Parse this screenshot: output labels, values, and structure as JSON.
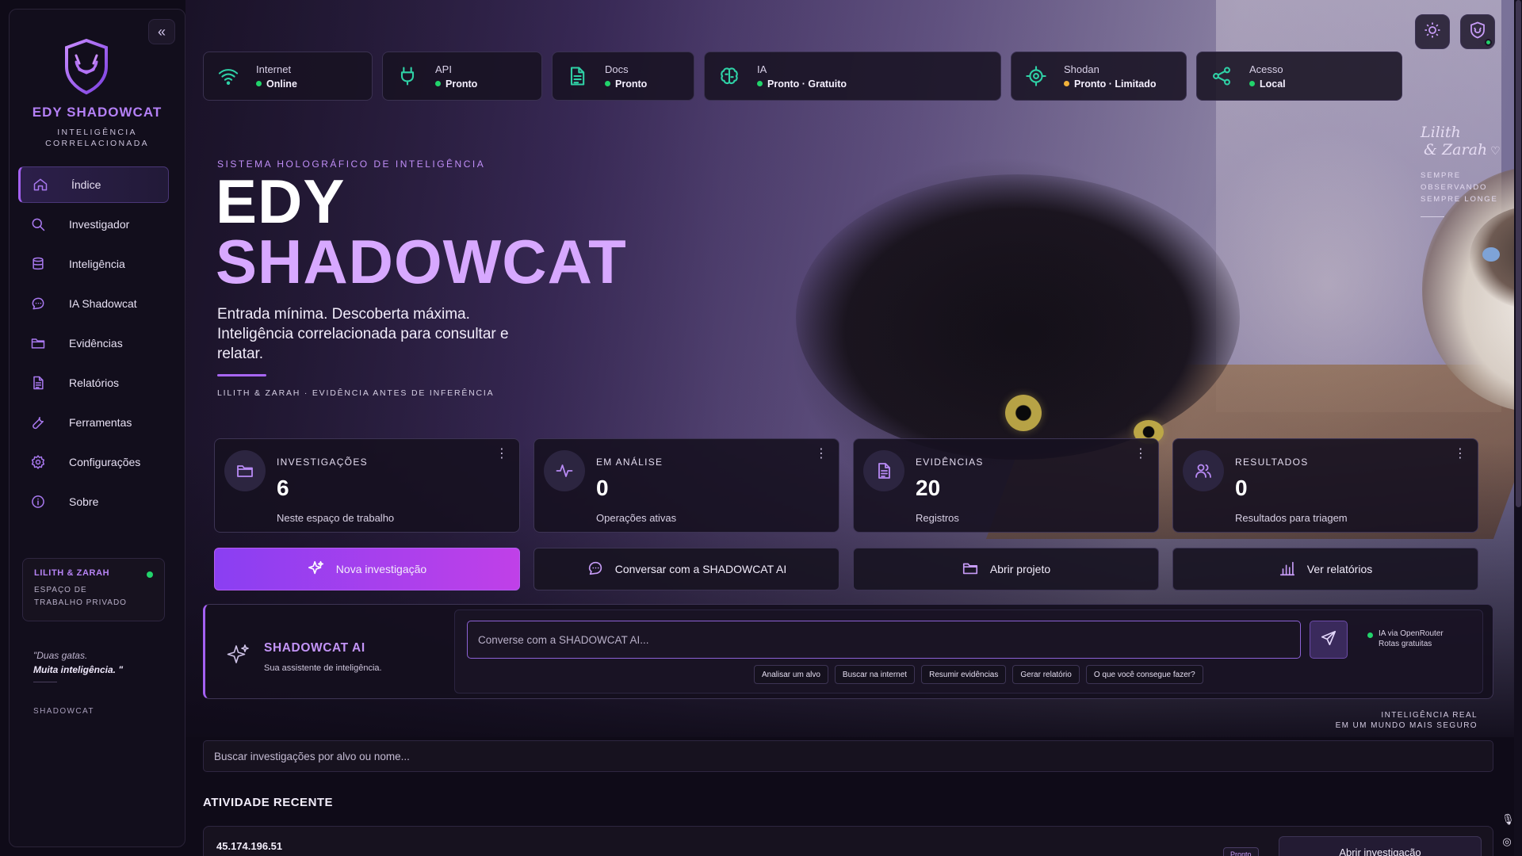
{
  "sidebar": {
    "brand_name": "EDY SHADOWCAT",
    "brand_sub": "INTELIGÊNCIA CORRELACIONADA",
    "collapse_glyph": "«",
    "items": [
      {
        "label": "Índice",
        "icon": "home-icon",
        "active": true
      },
      {
        "label": "Investigador",
        "icon": "search-icon"
      },
      {
        "label": "Inteligência",
        "icon": "database-icon"
      },
      {
        "label": "IA Shadowcat",
        "icon": "chat-icon"
      },
      {
        "label": "Evidências",
        "icon": "folder-icon"
      },
      {
        "label": "Relatórios",
        "icon": "document-icon"
      },
      {
        "label": "Ferramentas",
        "icon": "wrench-icon"
      },
      {
        "label": "Configurações",
        "icon": "gear-icon"
      },
      {
        "label": "Sobre",
        "icon": "info-icon"
      }
    ],
    "workspace": {
      "title": "LILITH & ZARAH",
      "subtitle": "ESPAÇO DE TRABALHO PRIVADO"
    },
    "quote_line1": "\"Duas gatas.",
    "quote_line2": "Muita inteligência. \"",
    "signature": "SHADOWCAT"
  },
  "status": [
    {
      "label": "Internet",
      "value": "Online",
      "icon": "wifi-icon",
      "dot_color": "#22d36b"
    },
    {
      "label": "API",
      "value": "Pronto",
      "icon": "plug-icon",
      "dot_color": "#22d36b"
    },
    {
      "label": "Docs",
      "value": "Pronto",
      "icon": "document-icon",
      "dot_color": "#22d36b"
    },
    {
      "label": "IA",
      "value": "Pronto · Gratuito",
      "icon": "brain-icon",
      "dot_color": "#22d36b"
    },
    {
      "label": "Shodan",
      "value": "Pronto · Limitado",
      "icon": "target-icon",
      "dot_color": "#f2b23a"
    },
    {
      "label": "Acesso",
      "value": "Local",
      "icon": "share-icon",
      "dot_color": "#22d36b"
    }
  ],
  "hero": {
    "eyebrow": "SISTEMA HOLOGRÁFICO DE INTELIGÊNCIA",
    "title_line1": "EDY",
    "title_line2": "SHADOWCAT",
    "subtitle": "Entrada mínima. Descoberta máxima. Inteligência correlacionada para consultar e relatar.",
    "tag": "LILITH & ZARAH · EVIDÊNCIA ANTES DE INFERÊNCIA"
  },
  "photo_note": {
    "script_line1": "Lilith",
    "script_line2": "& Zarah",
    "heart": "♡",
    "line1": "SEMPRE",
    "line2": "OBSERVANDO",
    "line3": "SEMPRE LONGE"
  },
  "stats": [
    {
      "key": "INVESTIGAÇÕES",
      "value": "6",
      "desc": "Neste espaço de trabalho",
      "icon": "folder-icon"
    },
    {
      "key": "EM ANÁLISE",
      "value": "0",
      "desc": "Operações ativas",
      "icon": "pulse-icon"
    },
    {
      "key": "EVIDÊNCIAS",
      "value": "20",
      "desc": "Registros",
      "icon": "document-icon"
    },
    {
      "key": "RESULTADOS",
      "value": "0",
      "desc": "Resultados para triagem",
      "icon": "users-icon"
    }
  ],
  "actions": [
    {
      "label": "Nova investigação",
      "icon": "sparkle-icon"
    },
    {
      "label": "Conversar com a SHADOWCAT AI",
      "icon": "chat-icon"
    },
    {
      "label": "Abrir projeto",
      "icon": "folder-icon"
    },
    {
      "label": "Ver relatórios",
      "icon": "bar-chart-icon"
    }
  ],
  "ai": {
    "title": "SHADOWCAT AI",
    "subtitle": "Sua assistente de inteligência.",
    "input_placeholder": "Converse com a SHADOWCAT AI...",
    "route_line1": "IA via OpenRouter",
    "route_line2": "Rotas gratuitas",
    "chips": [
      "Analisar um alvo",
      "Buscar na internet",
      "Resumir evidências",
      "Gerar relatório",
      "O que você consegue fazer?"
    ]
  },
  "tagline_line1": "INTELIGÊNCIA REAL",
  "tagline_line2": "EM UM MUNDO MAIS SEGURO",
  "search": {
    "placeholder": "Buscar investigações por alvo ou nome..."
  },
  "recent": {
    "title": "ATIVIDADE RECENTE",
    "rows": [
      {
        "target": "45.174.196.51",
        "badge": "Pronto",
        "action": "Abrir investigação"
      }
    ]
  },
  "colors": {
    "accent": "#a461f2",
    "brand": "#b480f6",
    "status_ok": "#22d36b",
    "status_warn": "#f2b23a"
  }
}
